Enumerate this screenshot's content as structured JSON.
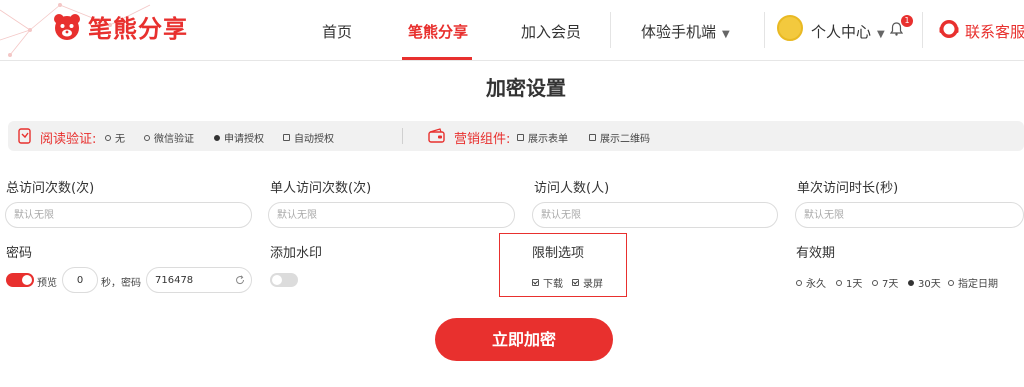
{
  "header": {
    "brand": "笔熊分享",
    "nav": [
      "首页",
      "笔熊分享",
      "加入会员",
      "体验手机端"
    ],
    "user_center": "个人中心",
    "notification_count": "1",
    "service": "联系客服"
  },
  "page_title": "加密设置",
  "options_bar": {
    "read_verify_label": "阅读验证:",
    "read_verify_options": [
      "无",
      "微信验证",
      "申请授权",
      "自动授权"
    ],
    "read_verify_selected": "申请授权",
    "marketing_label": "营销组件:",
    "marketing_options": [
      "展示表单",
      "展示二维码"
    ]
  },
  "fields": {
    "total_visits_label": "总访问次数(次)",
    "total_visits_placeholder": "默认无限",
    "single_visits_label": "单人访问次数(次)",
    "single_visits_placeholder": "默认无限",
    "visitors_label": "访问人数(人)",
    "visitors_placeholder": "默认无限",
    "duration_label": "单次访问时长(秒)",
    "duration_placeholder": "默认无限"
  },
  "password": {
    "label": "密码",
    "enabled": true,
    "preview_label": "预览",
    "preview_seconds": "0",
    "seconds_password_label": "秒，密码",
    "password_value": "716478"
  },
  "watermark": {
    "label": "添加水印",
    "enabled": false
  },
  "restrictions": {
    "label": "限制选项",
    "options": [
      "下载",
      "录屏"
    ],
    "checked": [
      "下载",
      "录屏"
    ]
  },
  "validity": {
    "label": "有效期",
    "options": [
      "永久",
      "1天",
      "7天",
      "30天",
      "指定日期"
    ],
    "selected": "30天"
  },
  "submit_label": "立即加密",
  "colors": {
    "brand_red": "#e8302e",
    "bar_bg": "#f1f1f1",
    "input_border": "#dcdcdc"
  }
}
